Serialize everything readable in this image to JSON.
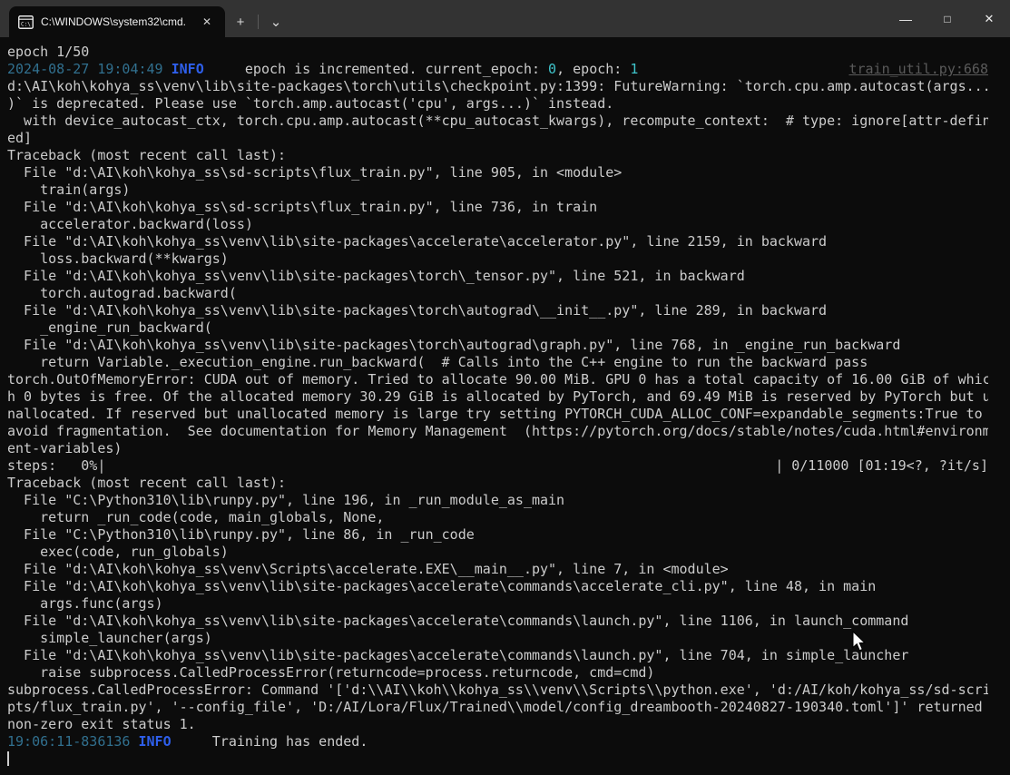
{
  "colors": {
    "fg": "#cccccc",
    "ts": "#31708f",
    "info": "#2e5feb",
    "num": "#3fc5cc",
    "meta": "#5a5a5a",
    "terminal_bg": "#0c0c0c",
    "titlebar_bg": "#333333"
  },
  "window": {
    "titlebar": {
      "tab": {
        "label": "C:\\WINDOWS\\system32\\cmd.",
        "close_icon": "✕"
      },
      "new_tab_icon": "+",
      "dropdown_icon": "⌄",
      "minimize_icon": "—",
      "maximize_icon": "□",
      "close_icon": "✕"
    }
  },
  "terminal": {
    "caret_visible": true,
    "lines": [
      [
        {
          "t": "epoch 1/50"
        }
      ],
      [
        {
          "t": "2024-08-27 19:04:49",
          "c": "ts"
        },
        {
          "t": " "
        },
        {
          "t": "INFO",
          "c": "info"
        },
        {
          "t": "     epoch is incremented. current_epoch: "
        },
        {
          "t": "0",
          "c": "num"
        },
        {
          "t": ", epoch: "
        },
        {
          "t": "1",
          "c": "num"
        },
        {
          "t": "train_util.py:668",
          "c": "meta",
          "right": true,
          "u": true
        }
      ],
      [
        {
          "t": "d:\\AI\\koh\\kohya_ss\\venv\\lib\\site-packages\\torch\\utils\\checkpoint.py:1399: FutureWarning: `torch.cpu.amp.autocast(args..."
        }
      ],
      [
        {
          "t": ")` is deprecated. Please use `torch.amp.autocast('cpu', args...)` instead."
        }
      ],
      [
        {
          "t": "  with device_autocast_ctx, torch.cpu.amp.autocast(**cpu_autocast_kwargs), recompute_context:  # type: ignore[attr-defin"
        }
      ],
      [
        {
          "t": "ed]"
        }
      ],
      [
        {
          "t": "Traceback (most recent call last):"
        }
      ],
      [
        {
          "t": "  File \"d:\\AI\\koh\\kohya_ss\\sd-scripts\\flux_train.py\", line 905, in <module>"
        }
      ],
      [
        {
          "t": "    train(args)"
        }
      ],
      [
        {
          "t": "  File \"d:\\AI\\koh\\kohya_ss\\sd-scripts\\flux_train.py\", line 736, in train"
        }
      ],
      [
        {
          "t": "    accelerator.backward(loss)"
        }
      ],
      [
        {
          "t": "  File \"d:\\AI\\koh\\kohya_ss\\venv\\lib\\site-packages\\accelerate\\accelerator.py\", line 2159, in backward"
        }
      ],
      [
        {
          "t": "    loss.backward(**kwargs)"
        }
      ],
      [
        {
          "t": "  File \"d:\\AI\\koh\\kohya_ss\\venv\\lib\\site-packages\\torch\\_tensor.py\", line 521, in backward"
        }
      ],
      [
        {
          "t": "    torch.autograd.backward("
        }
      ],
      [
        {
          "t": "  File \"d:\\AI\\koh\\kohya_ss\\venv\\lib\\site-packages\\torch\\autograd\\__init__.py\", line 289, in backward"
        }
      ],
      [
        {
          "t": "    _engine_run_backward("
        }
      ],
      [
        {
          "t": "  File \"d:\\AI\\koh\\kohya_ss\\venv\\lib\\site-packages\\torch\\autograd\\graph.py\", line 768, in _engine_run_backward"
        }
      ],
      [
        {
          "t": "    return Variable._execution_engine.run_backward(  # Calls into the C++ engine to run the backward pass"
        }
      ],
      [
        {
          "t": "torch.OutOfMemoryError: CUDA out of memory. Tried to allocate 90.00 MiB. GPU 0 has a total capacity of 16.00 GiB of whic"
        }
      ],
      [
        {
          "t": "h 0 bytes is free. Of the allocated memory 30.29 GiB is allocated by PyTorch, and 69.49 MiB is reserved by PyTorch but u"
        }
      ],
      [
        {
          "t": "nallocated. If reserved but unallocated memory is large try setting PYTORCH_CUDA_ALLOC_CONF=expandable_segments:True to"
        }
      ],
      [
        {
          "t": "avoid fragmentation.  See documentation for Memory Management  (https://pytorch.org/docs/stable/notes/cuda.html#environm"
        }
      ],
      [
        {
          "t": "ent-variables)"
        }
      ],
      [
        {
          "t": "steps:   0%|"
        },
        {
          "t": "| 0/11000 [01:19<?, ?it/s]",
          "right": true
        }
      ],
      [
        {
          "t": "Traceback (most recent call last):"
        }
      ],
      [
        {
          "t": "  File \"C:\\Python310\\lib\\runpy.py\", line 196, in _run_module_as_main"
        }
      ],
      [
        {
          "t": "    return _run_code(code, main_globals, None,"
        }
      ],
      [
        {
          "t": "  File \"C:\\Python310\\lib\\runpy.py\", line 86, in _run_code"
        }
      ],
      [
        {
          "t": "    exec(code, run_globals)"
        }
      ],
      [
        {
          "t": "  File \"d:\\AI\\koh\\kohya_ss\\venv\\Scripts\\accelerate.EXE\\__main__.py\", line 7, in <module>"
        }
      ],
      [
        {
          "t": "  File \"d:\\AI\\koh\\kohya_ss\\venv\\lib\\site-packages\\accelerate\\commands\\accelerate_cli.py\", line 48, in main"
        }
      ],
      [
        {
          "t": "    args.func(args)"
        }
      ],
      [
        {
          "t": "  File \"d:\\AI\\koh\\kohya_ss\\venv\\lib\\site-packages\\accelerate\\commands\\launch.py\", line 1106, in launch_command"
        }
      ],
      [
        {
          "t": "    simple_launcher(args)"
        }
      ],
      [
        {
          "t": "  File \"d:\\AI\\koh\\kohya_ss\\venv\\lib\\site-packages\\accelerate\\commands\\launch.py\", line 704, in simple_launcher"
        }
      ],
      [
        {
          "t": "    raise subprocess.CalledProcessError(returncode=process.returncode, cmd=cmd)"
        }
      ],
      [
        {
          "t": "subprocess.CalledProcessError: Command '['d:\\\\AI\\\\koh\\\\kohya_ss\\\\venv\\\\Scripts\\\\python.exe', 'd:/AI/koh/kohya_ss/sd-scri"
        }
      ],
      [
        {
          "t": "pts/flux_train.py', '--config_file', 'D:/AI/Lora/Flux/Trained\\\\model/config_dreambooth-20240827-190340.toml']' returned"
        }
      ],
      [
        {
          "t": "non-zero exit status 1."
        }
      ],
      [
        {
          "t": "19:06:11-836136",
          "c": "ts"
        },
        {
          "t": " "
        },
        {
          "t": "INFO",
          "c": "info"
        },
        {
          "t": "     Training has ended."
        }
      ]
    ]
  }
}
